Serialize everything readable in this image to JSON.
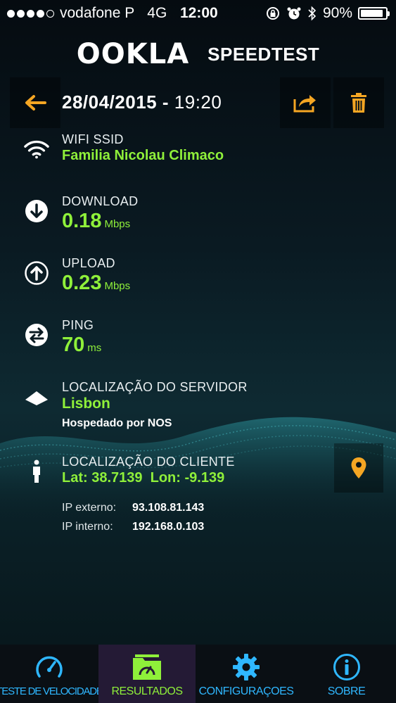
{
  "status_bar": {
    "carrier": "vodafone P",
    "network": "4G",
    "time": "12:00",
    "battery": "90%",
    "battery_level": 0.9
  },
  "brand": {
    "logo": "OOKLA",
    "app_name": "SPEEDTEST"
  },
  "header": {
    "date": "28/04/2015",
    "separator": "-",
    "time": "19:20",
    "back_icon": "arrow-left-icon",
    "share_icon": "share-icon",
    "delete_icon": "trash-icon"
  },
  "wifi": {
    "label": "WIFI SSID",
    "value": "Familia Nicolau Climaco"
  },
  "download": {
    "label": "DOWNLOAD",
    "value": "0.18",
    "unit": "Mbps"
  },
  "upload": {
    "label": "UPLOAD",
    "value": "0.23",
    "unit": "Mbps"
  },
  "ping": {
    "label": "PING",
    "value": "70",
    "unit": "ms"
  },
  "server": {
    "label": "LOCALIZAÇÃO DO SERVIDOR",
    "value": "Lisbon",
    "host": "Hospedado por NOS"
  },
  "client": {
    "label": "LOCALIZAÇÃO DO CLIENTE",
    "value": "Lat: 38.7139  Lon: -9.139",
    "ip_external_label": "IP externo:",
    "ip_external": "93.108.81.143",
    "ip_internal_label": "IP interno:",
    "ip_internal": "192.168.0.103"
  },
  "nav": {
    "items": [
      {
        "label": "TESTE DE VELOCIDADE",
        "icon": "speedometer-icon"
      },
      {
        "label": "RESULTADOS",
        "icon": "folder-gauge-icon"
      },
      {
        "label": "CONFIGURAÇOES",
        "icon": "gear-icon"
      },
      {
        "label": "SOBRE",
        "icon": "info-icon"
      }
    ],
    "active_index": 1
  },
  "colors": {
    "accent_green": "#8ff03a",
    "accent_orange": "#f5a623",
    "accent_blue": "#2fb7ff"
  }
}
